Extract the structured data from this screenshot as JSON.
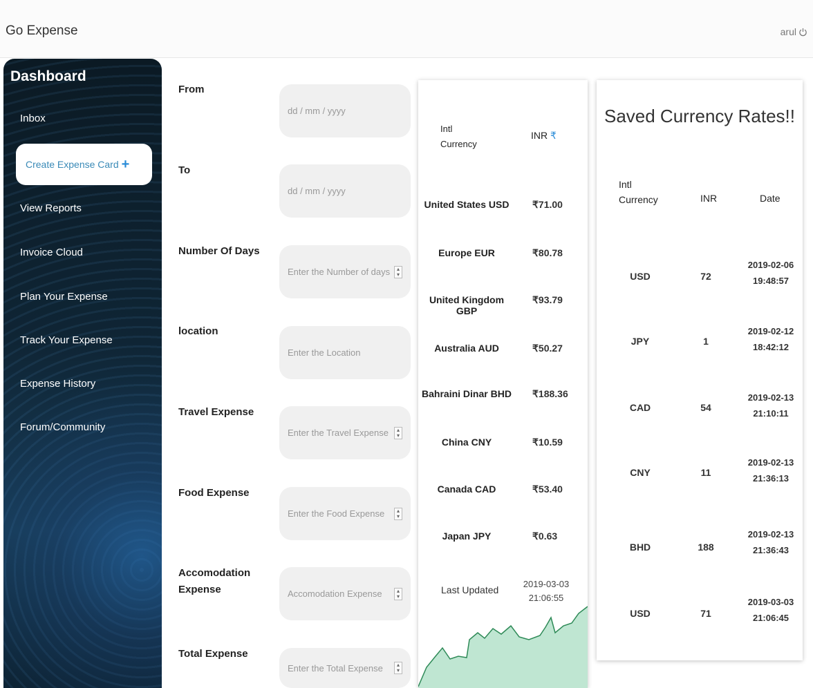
{
  "app": {
    "title": "Go Expense",
    "user": "arul"
  },
  "sidebar": {
    "title": "Dashboard",
    "items": [
      {
        "label": "Inbox"
      },
      {
        "label": "Create Expense Card",
        "active": true
      },
      {
        "label": "View Reports"
      },
      {
        "label": "Invoice Cloud"
      },
      {
        "label": "Plan Your Expense"
      },
      {
        "label": "Track Your Expense"
      },
      {
        "label": "Expense History"
      },
      {
        "label": "Forum/Community"
      }
    ]
  },
  "form": {
    "from_label": "From",
    "from_placeholder": "dd / mm / yyyy",
    "to_label": "To",
    "to_placeholder": "dd / mm / yyyy",
    "days_label": "Number Of Days",
    "days_placeholder": "Enter the Number of days",
    "location_label": "location",
    "location_placeholder": "Enter the Location",
    "travel_label": "Travel Expense",
    "travel_placeholder": "Enter the Travel Expense",
    "food_label": "Food Expense",
    "food_placeholder": "Enter the Food Expense",
    "accom_label_1": "Accomodation",
    "accom_label_2": "Expense",
    "accom_placeholder": "Accomodation Expense",
    "total_label": "Total Expense",
    "total_placeholder": "Enter the Total Expense"
  },
  "rates": {
    "header_currency_1": "Intl",
    "header_currency_2": "Currency",
    "header_inr": "INR",
    "rupee_symbol": "₹",
    "rows": [
      {
        "name": "United States USD",
        "value": "₹71.00"
      },
      {
        "name": "Europe EUR",
        "value": "₹80.78"
      },
      {
        "name": "United Kingdom GBP",
        "value": "₹93.79"
      },
      {
        "name": "Australia AUD",
        "value": "₹50.27"
      },
      {
        "name": "Bahraini Dinar BHD",
        "value": "₹188.36"
      },
      {
        "name": "China CNY",
        "value": "₹10.59"
      },
      {
        "name": "Canada CAD",
        "value": "₹53.40"
      },
      {
        "name": "Japan JPY",
        "value": "₹0.63"
      }
    ],
    "last_updated_label": "Last Updated",
    "last_updated_date": "2019-03-03",
    "last_updated_time": "21:06:55"
  },
  "saved": {
    "title": "Saved Currency Rates!!",
    "header_currency_1": "Intl",
    "header_currency_2": "Currency",
    "header_inr": "INR",
    "header_date": "Date",
    "rows": [
      {
        "currency": "USD",
        "inr": "72",
        "date": "2019-02-06",
        "time": "19:48:57"
      },
      {
        "currency": "JPY",
        "inr": "1",
        "date": "2019-02-12",
        "time": "18:42:12"
      },
      {
        "currency": "CAD",
        "inr": "54",
        "date": "2019-02-13",
        "time": "21:10:11"
      },
      {
        "currency": "CNY",
        "inr": "11",
        "date": "2019-02-13",
        "time": "21:36:13"
      },
      {
        "currency": "BHD",
        "inr": "188",
        "date": "2019-02-13",
        "time": "21:36:43"
      },
      {
        "currency": "USD",
        "inr": "71",
        "date": "2019-03-03",
        "time": "21:06:45"
      }
    ]
  },
  "colors": {
    "accent": "#2a8cd8",
    "sidebar_dark": "#0f2535",
    "spark_fill": "#bfe6d2",
    "spark_line": "#2e8a57"
  }
}
